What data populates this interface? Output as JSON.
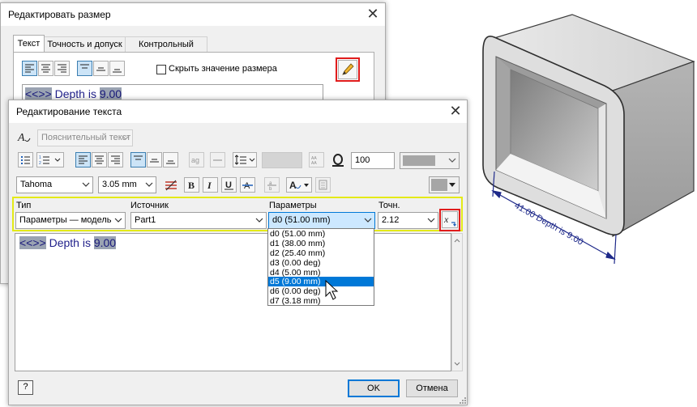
{
  "outer_dialog": {
    "title": "Редактировать размер",
    "tabs": [
      "Текст",
      "Точность и допуск",
      "Контрольный размер"
    ],
    "hide_value_label": "Скрыть значение размера",
    "preview_code": "<<>>",
    "preview_text": "Depth is",
    "preview_value": "9.00"
  },
  "text_dialog": {
    "title": "Редактирование текста",
    "style_combo": "Пояснительный текст",
    "font": "Tahoma",
    "font_size": "3.05 mm",
    "width_percent": "100",
    "fields": {
      "type_label": "Тип",
      "type_value": "Параметры — модель",
      "source_label": "Источник",
      "source_value": "Part1",
      "params_label": "Параметры",
      "params_value": "d0 (51.00 mm)",
      "precision_label": "Точн.",
      "precision_value": "2.12"
    },
    "param_options": [
      "d0 (51.00 mm)",
      "d1 (38.00 mm)",
      "d2 (25.40 mm)",
      "d3 (0.00 deg)",
      "d4 (5.00 mm)",
      "d5 (9.00 mm)",
      "d6 (0.00 deg)",
      "d7 (3.18 mm)"
    ],
    "selected_option_index": 5,
    "editor_code": "<<>>",
    "editor_text": "Depth is",
    "editor_value": "9.00",
    "ok_label": "OK",
    "cancel_label": "Отмена",
    "help_label": "?"
  },
  "model": {
    "dimension_label": "41.00 Depth is 9.00"
  },
  "colors": {
    "highlight_red": "#e01c1c",
    "highlight_yellow": "#e4ea18",
    "dimension_blue": "#1f2a8a",
    "selection_blue": "#0078d7"
  }
}
